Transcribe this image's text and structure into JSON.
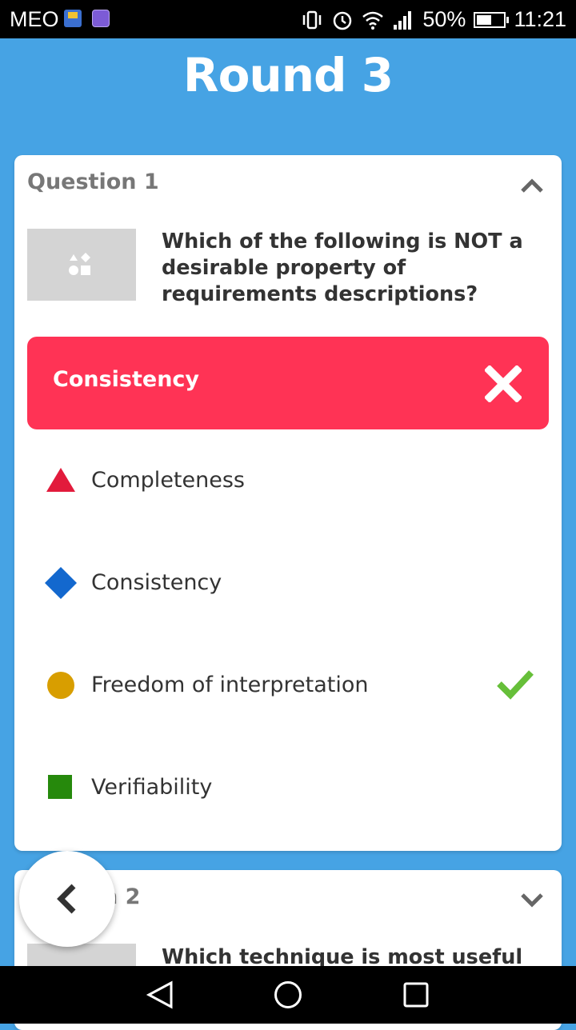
{
  "status_bar": {
    "carrier": "MEO",
    "battery": "50%",
    "time": "11:21",
    "icons": [
      "app-notification-icon",
      "gallery-icon",
      "vibrate-icon",
      "alarm-icon",
      "wifi-icon",
      "signal-icon",
      "battery-icon"
    ]
  },
  "title": "Round 3",
  "question1": {
    "heading": "Question 1",
    "text": "Which of the following is NOT a desirable property of requirements descriptions?",
    "selected_answer": "Consistency",
    "selected_color": "#ff3355",
    "options": [
      {
        "label": "Completeness",
        "shape": "triangle",
        "color": "#e21b3c"
      },
      {
        "label": "Consistency",
        "shape": "diamond",
        "color": "#1368ce"
      },
      {
        "label": "Freedom of interpretation",
        "shape": "circle",
        "color": "#d89e00",
        "correct": true
      },
      {
        "label": "Verifiability",
        "shape": "square",
        "color": "#26890c"
      }
    ]
  },
  "question2": {
    "heading_visible": "n 2",
    "text_visible": "Which technique is most useful"
  },
  "accent": "#46a3e4",
  "correct_color": "#66bf39"
}
